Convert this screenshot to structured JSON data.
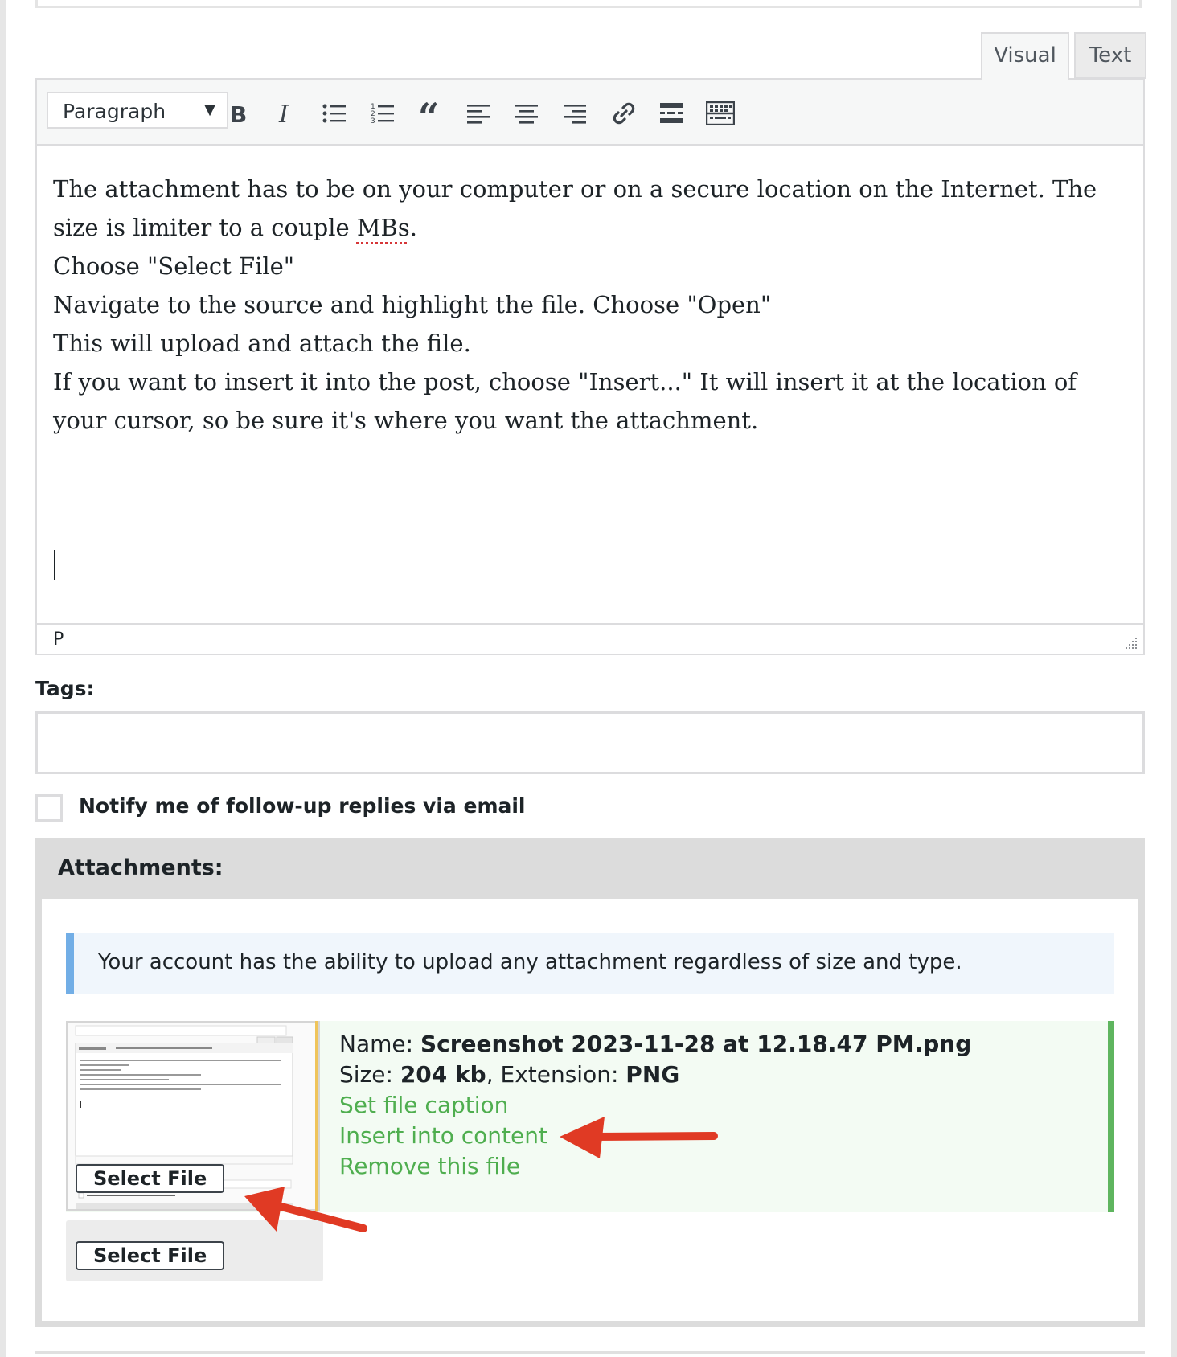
{
  "editor": {
    "tabs": {
      "visual": "Visual",
      "text": "Text"
    },
    "format_select": "Paragraph",
    "toolbar_icons": [
      "bold-icon",
      "italic-icon",
      "bullet-list-icon",
      "numbered-list-icon",
      "blockquote-icon",
      "align-left-icon",
      "align-center-icon",
      "align-right-icon",
      "link-icon",
      "read-more-icon",
      "toolbar-toggle-icon"
    ],
    "paragraphs": {
      "p1a": "The attachment has to be on your computer or on a secure location on the Internet. The size is limiter to a couple ",
      "p1b": "MBs",
      "p1c": ".",
      "p2": "Choose \"Select File\"",
      "p3": "Navigate to the source and highlight the file. Choose \"Open\"",
      "p4": "This will upload and attach the file.",
      "p5": "If you want to insert it into the post, choose \"Insert...\" It will insert it at the location of your cursor, so be sure it's where you want the attachment."
    },
    "status_path": "P"
  },
  "tags": {
    "label": "Tags:",
    "value": ""
  },
  "notify": {
    "label": "Notify me of follow-up replies via email",
    "checked": false
  },
  "attachments": {
    "title": "Attachments:",
    "notice": "Your account has the ability to upload any attachment regardless of size and type.",
    "file": {
      "name_label": "Name:",
      "name": "Screenshot 2023-11-28 at 12.18.47 PM.png",
      "size_label": "Size:",
      "size": "204 kb",
      "ext_label": "Extension:",
      "ext": "PNG",
      "actions": {
        "caption": "Set file caption",
        "insert": "Insert into content",
        "remove": "Remove this file"
      }
    },
    "select_file_overlay": "Select File",
    "select_file": "Select File"
  },
  "colors": {
    "link_green": "#4fae4f",
    "card_border": "#5fb55f",
    "notice_border": "#72aee6",
    "arrow_red": "#e03a24"
  }
}
